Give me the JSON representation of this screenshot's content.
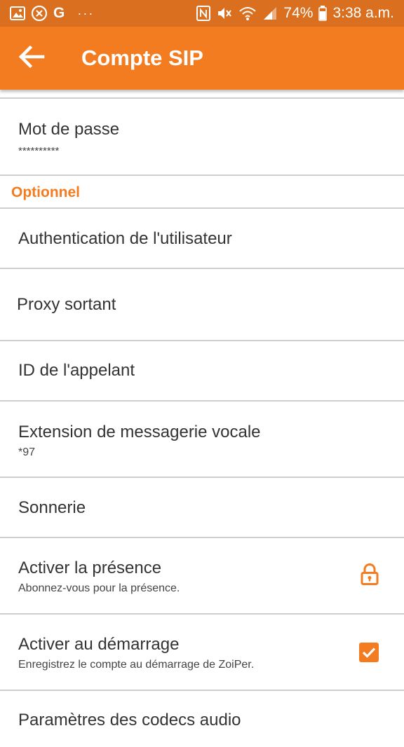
{
  "status_bar": {
    "battery": "74%",
    "time": "3:38 a.m.",
    "left_icons": [
      "image-icon",
      "cancel-circle-icon",
      "google-icon",
      "more-dots-icon"
    ],
    "right_icons": [
      "nfc-icon",
      "mute-icon",
      "wifi-icon",
      "signal-icon",
      "battery-icon"
    ],
    "google_glyph": "G",
    "more_dots": "···"
  },
  "app_bar": {
    "title": "Compte SIP",
    "back_icon": "arrow-back-icon",
    "color": "#f47c20"
  },
  "settings": {
    "password": {
      "title": "Mot de passe",
      "value": "**********"
    },
    "section_optional": "Optionnel",
    "auth_user": {
      "title": "Authentication de l'utilisateur"
    },
    "outbound_proxy": {
      "title": "Proxy sortant"
    },
    "caller_id": {
      "title": "ID de l'appelant"
    },
    "voicemail": {
      "title": "Extension de messagerie vocale",
      "value": "*97"
    },
    "ringtone": {
      "title": "Sonnerie"
    },
    "presence": {
      "title": "Activer la présence",
      "subtitle": "Abonnez-vous pour la présence.",
      "icon": "lock-icon",
      "locked": true
    },
    "startup": {
      "title": "Activer au démarrage",
      "subtitle": "Enregistrez le compte au démarrage de ZoiPer.",
      "checked": true
    },
    "partial_next": {
      "title": "Paramètres des codecs audio"
    }
  },
  "colors": {
    "accent": "#f47c20",
    "status_bar": "#d96f1f",
    "divider": "#cfcfcf",
    "text": "#333333"
  }
}
